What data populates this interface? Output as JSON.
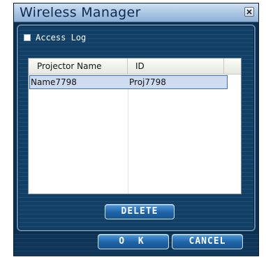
{
  "window": {
    "title": "Wireless Manager"
  },
  "access_log": {
    "label": "Access Log",
    "checked": false
  },
  "list": {
    "columns": [
      "Projector Name",
      "ID"
    ],
    "rows": [
      {
        "name": "Name7798",
        "id": "Proj7798",
        "selected": true
      }
    ]
  },
  "buttons": {
    "delete": "DELETE",
    "ok": "O K",
    "cancel": "CANCEL"
  },
  "colors": {
    "panel_background": "#123f66",
    "titlebar": "#a9c4e2",
    "button": "#1f63a7",
    "selection": "#cfdcf0"
  },
  "icons": {
    "close": "close-icon"
  }
}
